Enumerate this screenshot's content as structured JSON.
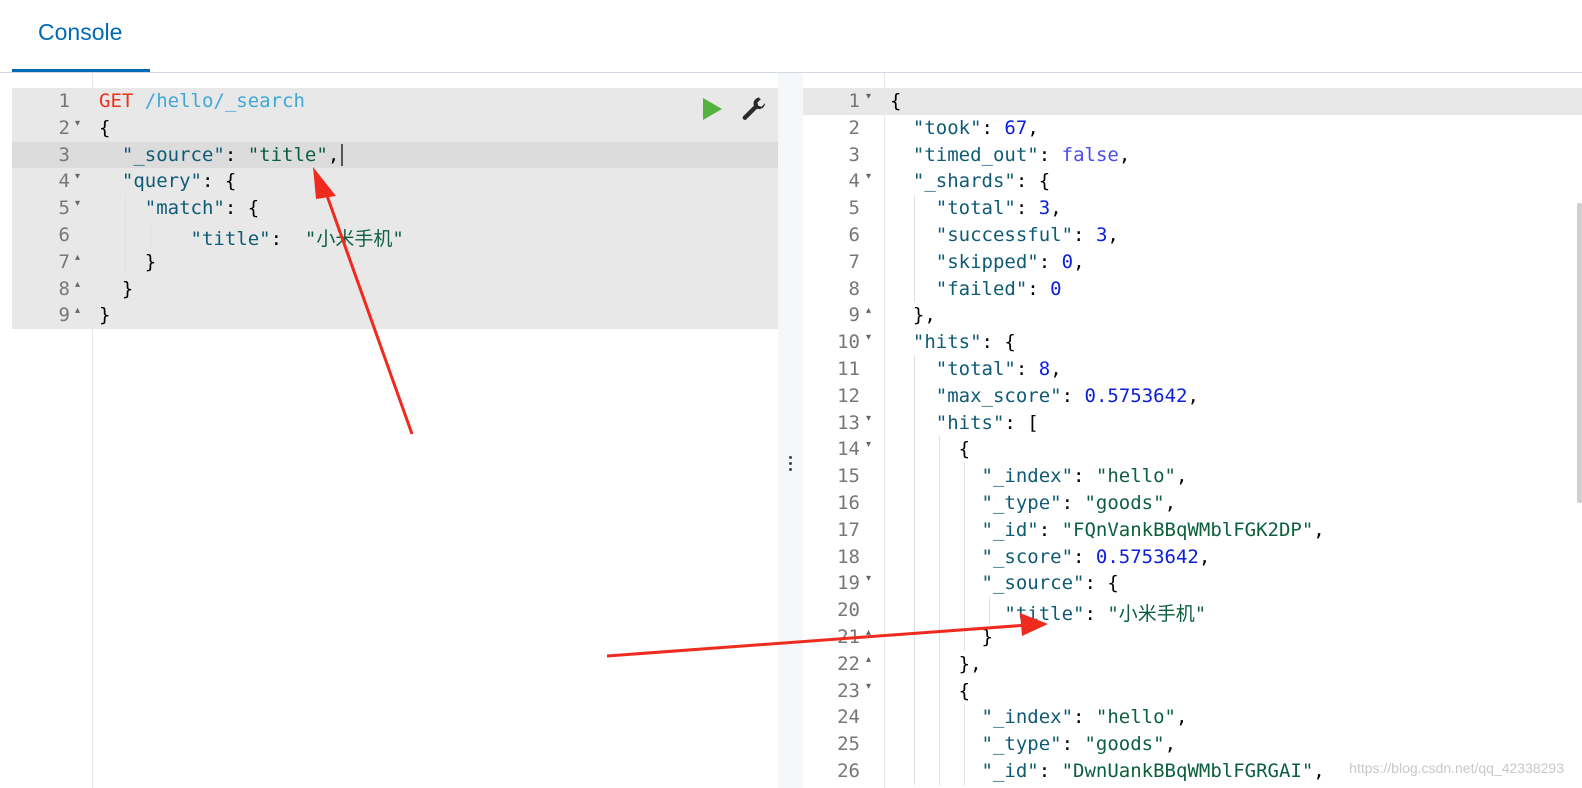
{
  "tabs": [
    {
      "label": "Console"
    }
  ],
  "request": {
    "lines": [
      {
        "num": "1",
        "text": "GET /hello/_search"
      },
      {
        "num": "2",
        "text": "{"
      },
      {
        "num": "3",
        "text": "  \"_source\": \"title\","
      },
      {
        "num": "4",
        "text": "  \"query\": {"
      },
      {
        "num": "5",
        "text": "    \"match\": {"
      },
      {
        "num": "6",
        "text": "        \"title\":  \"小米手机\""
      },
      {
        "num": "7",
        "text": "    }"
      },
      {
        "num": "8",
        "text": "  }"
      },
      {
        "num": "9",
        "text": "}"
      }
    ],
    "method": "GET",
    "path": "/hello/_search"
  },
  "response": {
    "lines": [
      {
        "num": "1",
        "text": "{"
      },
      {
        "num": "2",
        "text": "  \"took\": 67,"
      },
      {
        "num": "3",
        "text": "  \"timed_out\": false,"
      },
      {
        "num": "4",
        "text": "  \"_shards\": {"
      },
      {
        "num": "5",
        "text": "    \"total\": 3,"
      },
      {
        "num": "6",
        "text": "    \"successful\": 3,"
      },
      {
        "num": "7",
        "text": "    \"skipped\": 0,"
      },
      {
        "num": "8",
        "text": "    \"failed\": 0"
      },
      {
        "num": "9",
        "text": "  },"
      },
      {
        "num": "10",
        "text": "  \"hits\": {"
      },
      {
        "num": "11",
        "text": "    \"total\": 8,"
      },
      {
        "num": "12",
        "text": "    \"max_score\": 0.5753642,"
      },
      {
        "num": "13",
        "text": "    \"hits\": ["
      },
      {
        "num": "14",
        "text": "      {"
      },
      {
        "num": "15",
        "text": "        \"_index\": \"hello\","
      },
      {
        "num": "16",
        "text": "        \"_type\": \"goods\","
      },
      {
        "num": "17",
        "text": "        \"_id\": \"FQnVankBBqWMblFGK2DP\","
      },
      {
        "num": "18",
        "text": "        \"_score\": 0.5753642,"
      },
      {
        "num": "19",
        "text": "        \"_source\": {"
      },
      {
        "num": "20",
        "text": "          \"title\": \"小米手机\""
      },
      {
        "num": "21",
        "text": "        }"
      },
      {
        "num": "22",
        "text": "      },"
      },
      {
        "num": "23",
        "text": "      {"
      },
      {
        "num": "24",
        "text": "        \"_index\": \"hello\","
      },
      {
        "num": "25",
        "text": "        \"_type\": \"goods\","
      },
      {
        "num": "26",
        "text": "        \"_id\": \"DwnUankBBqWMblFGRGAI\","
      }
    ]
  },
  "icons": {
    "run": "play-icon",
    "settings": "wrench-icon"
  },
  "colors": {
    "accent": "#006bb4",
    "run_green": "#54b33e",
    "arrow_red": "#ee2b1e"
  },
  "watermark": "https://blog.csdn.net/qq_42338293"
}
